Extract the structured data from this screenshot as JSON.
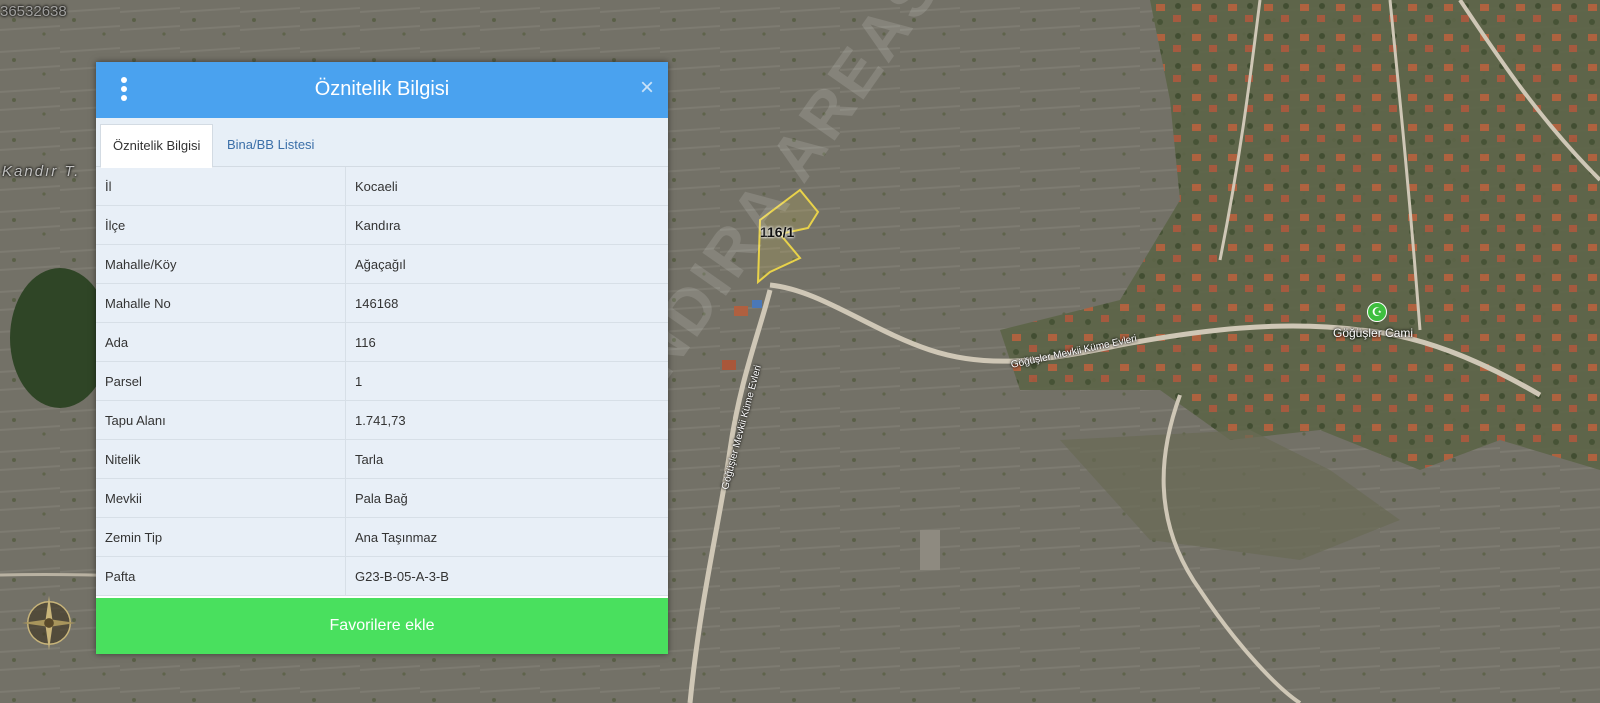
{
  "map": {
    "top_id_text": "36532638",
    "area_label": "Kandır T.",
    "parcel_label": "116/1",
    "mosque_label": "Göğüşler Cami",
    "road_label_1": "Göğüşler Mevkii Küme Evleri",
    "road_label_2": "Göğüşler Mevkii Küme Evleri",
    "watermark": "KANDIRA AREAS"
  },
  "panel": {
    "title": "Öznitelik Bilgisi",
    "close_symbol": "×",
    "tabs": [
      {
        "label": "Öznitelik Bilgisi",
        "active": true
      },
      {
        "label": "Bina/BB Listesi",
        "active": false
      }
    ],
    "rows": [
      {
        "key": "İl",
        "value": "Kocaeli"
      },
      {
        "key": "İlçe",
        "value": "Kandıra"
      },
      {
        "key": "Mahalle/Köy",
        "value": "Ağaçağıl"
      },
      {
        "key": "Mahalle No",
        "value": "146168"
      },
      {
        "key": "Ada",
        "value": "116"
      },
      {
        "key": "Parsel",
        "value": "1"
      },
      {
        "key": "Tapu Alanı",
        "value": "1.741,73"
      },
      {
        "key": "Nitelik",
        "value": "Tarla"
      },
      {
        "key": "Mevkii",
        "value": "Pala Bağ"
      },
      {
        "key": "Zemin Tip",
        "value": "Ana Taşınmaz"
      },
      {
        "key": "Pafta",
        "value": "G23-B-05-A-3-B"
      }
    ],
    "favorite_button": "Favorilere ekle"
  },
  "colors": {
    "header": "#4aa2ef",
    "favorite_button": "#49e05e",
    "parcel_outline": "#e8d24a"
  },
  "icons": {
    "menu": "kebab-menu-icon",
    "close": "close-icon",
    "mosque": "mosque-icon",
    "compass": "compass-icon"
  }
}
